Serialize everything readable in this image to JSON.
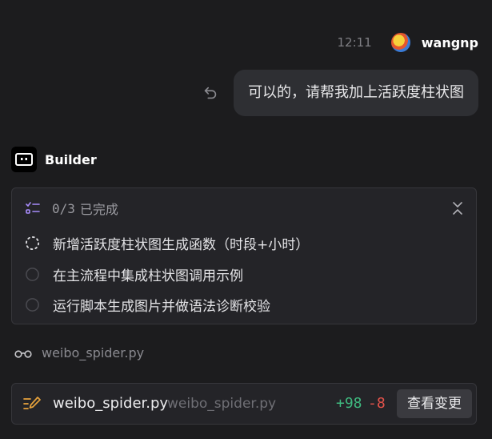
{
  "header": {
    "time": "12:11",
    "username": "wangnp"
  },
  "user_message": {
    "text": "可以的，请帮我加上活跃度柱状图"
  },
  "assistant": {
    "name": "Builder"
  },
  "tasks": {
    "progress": "0/3",
    "status_label": "已完成",
    "items": [
      {
        "label": "新增活跃度柱状图生成函数（时段+小时）",
        "state": "in-progress"
      },
      {
        "label": "在主流程中集成柱状图调用示例",
        "state": "pending"
      },
      {
        "label": "运行脚本生成图片并做语法诊断校验",
        "state": "pending"
      }
    ]
  },
  "viewed_file": {
    "name": "weibo_spider.py"
  },
  "change": {
    "file_name": "weibo_spider.py",
    "file_path": "weibo_spider.py",
    "additions": "+98",
    "deletions": "-8",
    "view_button": "查看变更"
  },
  "colors": {
    "background": "#1c1c1e",
    "bubble": "#2e2f33",
    "card": "#242428",
    "accent_task": "#a78bfa",
    "additions": "#3fb97f",
    "deletions": "#e5534b",
    "edit_icon": "#e6a23c"
  }
}
